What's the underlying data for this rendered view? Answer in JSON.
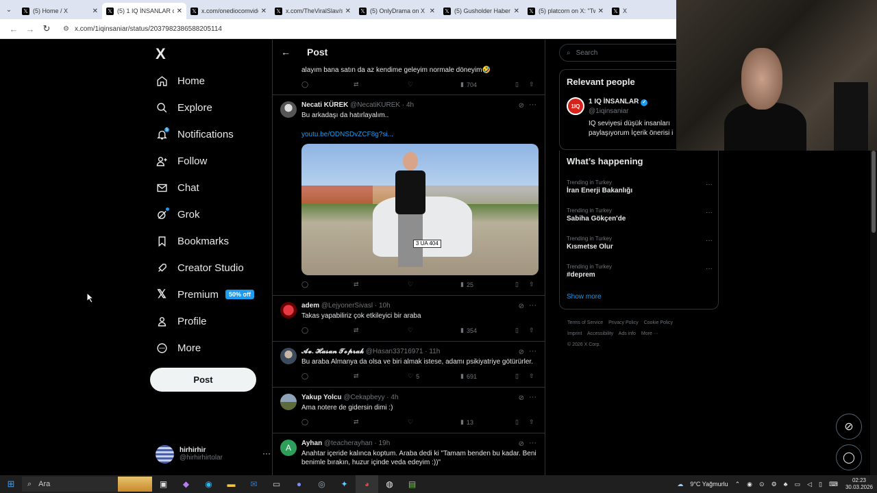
{
  "browser": {
    "tabs": [
      {
        "title": "(5) Home / X",
        "active": false
      },
      {
        "title": "(5) 1 IQ İNSANLAR on X",
        "active": true
      },
      {
        "title": "x.com/onediocomvideo",
        "active": false
      },
      {
        "title": "x.com/TheViralSlav/st",
        "active": false
      },
      {
        "title": "(5) OnlyDrama on X",
        "active": false
      },
      {
        "title": "(5) Gusholder Haber",
        "active": false
      },
      {
        "title": "(5) platcorn on X: \"Tw",
        "active": false
      },
      {
        "title": "X",
        "active": false
      }
    ],
    "url": "x.com/1iqinsaniar/status/2037982386588205114"
  },
  "sidebar": {
    "logo": "X",
    "items": [
      {
        "label": "Home",
        "icon": "home-icon"
      },
      {
        "label": "Explore",
        "icon": "search-icon"
      },
      {
        "label": "Notifications",
        "icon": "bell-icon",
        "badge": "5"
      },
      {
        "label": "Follow",
        "icon": "person-plus-icon"
      },
      {
        "label": "Chat",
        "icon": "envelope-icon"
      },
      {
        "label": "Grok",
        "icon": "grok-icon"
      },
      {
        "label": "Bookmarks",
        "icon": "bookmark-icon"
      },
      {
        "label": "Creator Studio",
        "icon": "rocket-icon"
      },
      {
        "label": "Premium",
        "icon": "x-icon",
        "badge": "50% off"
      },
      {
        "label": "Profile",
        "icon": "person-icon"
      },
      {
        "label": "More",
        "icon": "more-circle-icon"
      }
    ],
    "post_button": "Post",
    "account": {
      "name": "hirhirhir",
      "handle": "@hirhirhirtolar",
      "more": "···"
    }
  },
  "main": {
    "header": "Post",
    "tweets": [
      {
        "id": "t0",
        "text": "alayım bana satın da az kendime geleyim normale döneyim🤣",
        "replies": "",
        "retweets": "",
        "likes": "",
        "views": "704"
      },
      {
        "id": "t1",
        "name": "Necati KÜREK",
        "handle": "@NecatiKUREK · 4h",
        "text": "Bu arkadaşı da hatırlayalım..",
        "link": "youtu.be/ODNSDvZCF8g?si...",
        "plate": "3 UA 404",
        "views": "25"
      },
      {
        "id": "t2",
        "name": "adem",
        "handle": "@LejyonerSivasl · 10h",
        "text": "Takas yapabiliriz çok etkileyici bir araba",
        "views": "354"
      },
      {
        "id": "t3",
        "name": "𝓐𝓿. 𝓗𝓪𝓼𝓪𝓷 𝓣𝓸𝓹𝓻𝓪𝓴",
        "handle": "@Hasan33716971 · 11h",
        "text": "Bu araba Almanya da olsa ve biri almak istese, adamı psikiyatriye götürürler.",
        "likes": "5",
        "views": "691"
      },
      {
        "id": "t4",
        "name": "Yakup Yolcu",
        "handle": "@Cekapbeyy · 4h",
        "text": "Ama notere de gidersin dimi :)",
        "views": "13"
      },
      {
        "id": "t5",
        "name": "Ayhan",
        "handle": "@teacherayhan · 19h",
        "avatar_letter": "A",
        "text": "Anahtar içeride kalınca koptum. Araba dedi ki \"Tamam benden bu kadar. Beni benimle bırakın, huzur içinde veda edeyim :))\""
      }
    ]
  },
  "right": {
    "search_placeholder": "Search",
    "relevant": {
      "title": "Relevant people",
      "name": "1 IQ İNSANLAR",
      "handle": "@1iqinsaniar",
      "bio": "IQ seviyesi düşük insanları paylaşıyorum İçerik önerisi i"
    },
    "happening": {
      "title": "What’s happening",
      "trends": [
        {
          "category": "Trending in Turkey",
          "topic": "İran Enerji Bakanlığı"
        },
        {
          "category": "Trending in Turkey",
          "topic": "Sabiha Gökçen'de"
        },
        {
          "category": "Trending in Turkey",
          "topic": "Kısmetse Olur"
        },
        {
          "category": "Trending in Turkey",
          "topic": "#deprem"
        }
      ],
      "show_more": "Show more"
    },
    "footer": [
      "Terms of Service",
      "Privacy Policy",
      "Cookie Policy",
      "Imprint",
      "Accessibility",
      "Ads info",
      "More ···",
      "© 2026 X Corp."
    ]
  },
  "taskbar": {
    "search": "Ara",
    "weather": "9°C  Yağmurlu",
    "time": "02:23",
    "date": "30.03.2026"
  }
}
